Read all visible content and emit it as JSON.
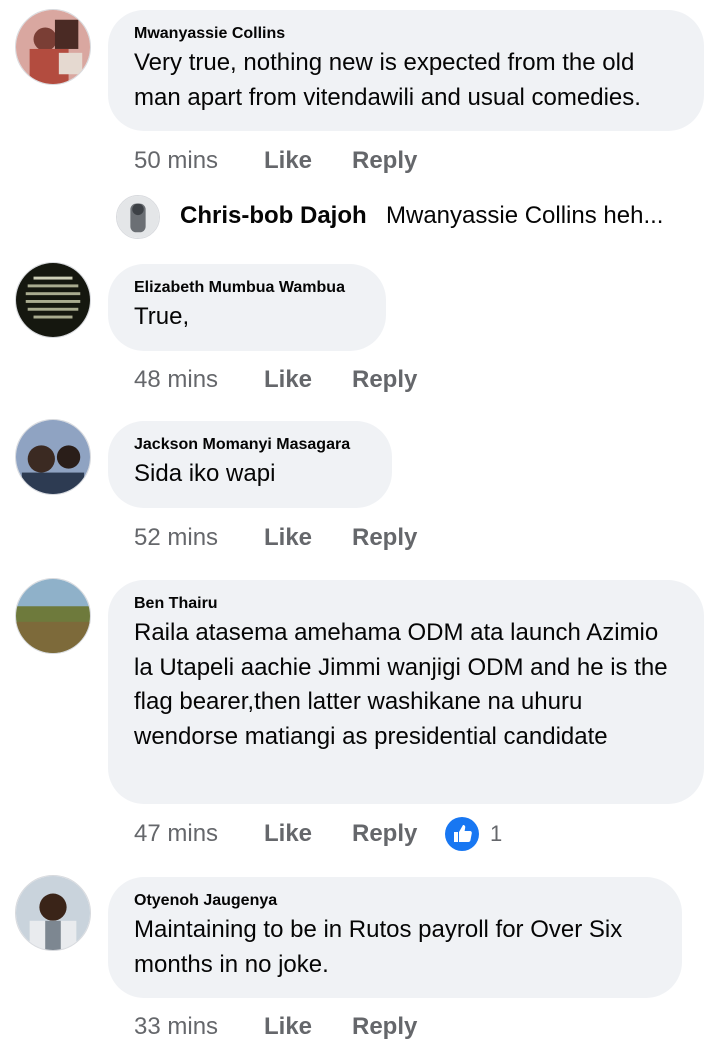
{
  "comments": [
    {
      "author": "Mwanyassie Collins",
      "text": "Very true, nothing new is expected from the old man apart from vitendawili and usual comedies.",
      "time": "50 mins",
      "like": "Like",
      "reply": "Reply",
      "avatar": "photo-avatar"
    },
    {
      "author": "Elizabeth Mumbua Wambua",
      "text": "True,",
      "time": "48 mins",
      "like": "Like",
      "reply": "Reply",
      "avatar": "text-image-avatar"
    },
    {
      "author": "Jackson Momanyi Masagara",
      "text": "Sida iko wapi",
      "time": "52 mins",
      "like": "Like",
      "reply": "Reply",
      "avatar": "photo-avatar"
    },
    {
      "author": "Ben Thairu",
      "text": "Raila atasema amehama ODM ata launch Azimio la Utapeli aachie Jimmi wanjigi ODM and he is the flag bearer,then latter washikane na uhuru wendorse matiangi as presidential candidate",
      "time": "47 mins",
      "like": "Like",
      "reply": "Reply",
      "reaction_icon": "like-reaction-icon",
      "reaction_count": "1",
      "avatar": "landscape-avatar"
    },
    {
      "author": "Otyenoh Jaugenya",
      "text": "Maintaining to be in Rutos  payroll for Over Six months in no joke.",
      "time": "33 mins",
      "like": "Like",
      "reply": "Reply",
      "avatar": "photo-avatar"
    }
  ],
  "reply_preview": {
    "author": "Chris-bob Dajoh",
    "text": "Mwanyassie Collins heh..."
  },
  "colors": {
    "bubble": "#f0f2f5",
    "text": "#050505",
    "meta": "#65676b",
    "like_blue": "#1877f2"
  }
}
